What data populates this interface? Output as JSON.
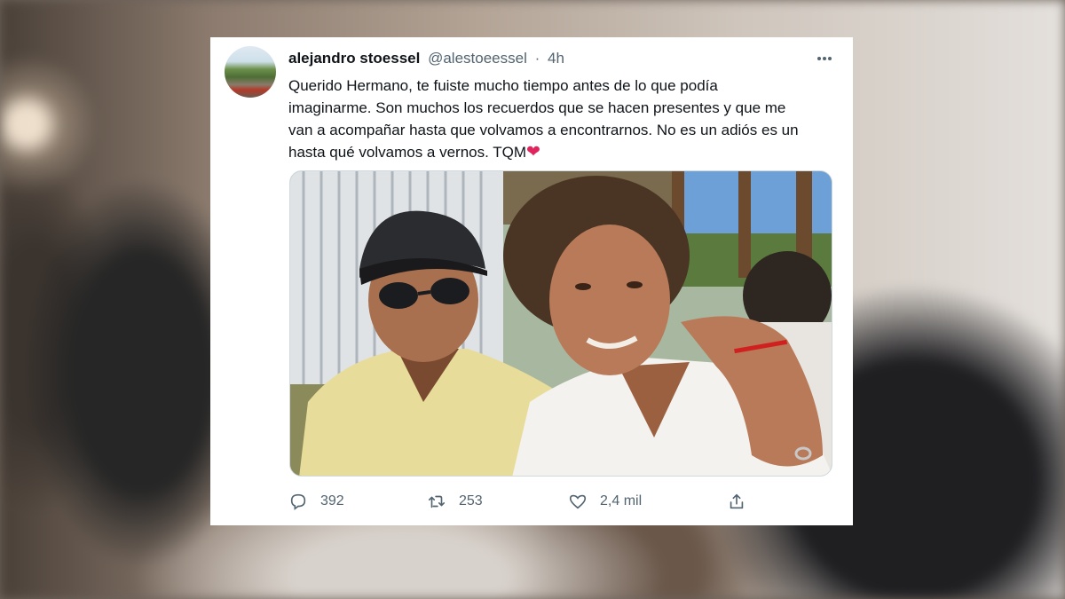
{
  "tweet": {
    "author_name": "alejandro stoessel",
    "handle": "@alestoeessel",
    "separator": "·",
    "time": "4h",
    "more_icon": "more-horizontal-icon",
    "text_lines": [
      "Querido Hermano, te fuiste mucho tiempo antes de lo que podía",
      "imaginarme. Son muchos los recuerdos que se hacen presentes y que me",
      "van a acompañar hasta que volvamos a encontrarnos. No es un adiós es un",
      "hasta qué volvamos a vernos. TQM"
    ],
    "heart_emoji": "❤",
    "actions": {
      "replies": "392",
      "retweets": "253",
      "likes": "2,4 mil"
    }
  },
  "colors": {
    "text": "#0f1419",
    "secondary": "#536471",
    "heart": "#e0245e"
  }
}
